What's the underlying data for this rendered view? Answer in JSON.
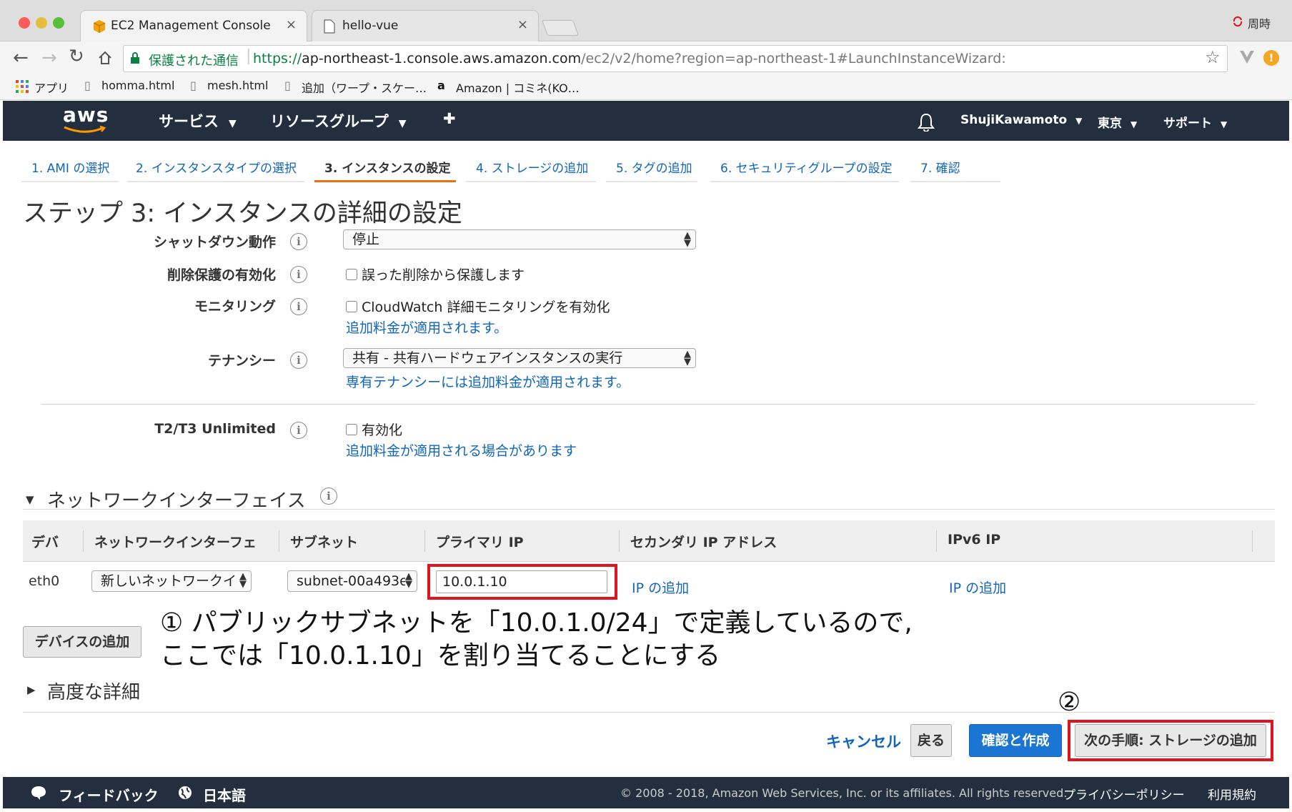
{
  "browser": {
    "tabs": [
      {
        "title": "EC2 Management Console",
        "icon": "aws-cube-icon"
      },
      {
        "title": "hello-vue",
        "icon": "page-icon"
      }
    ],
    "profile_label": "周時",
    "secure_label": "保護された通信",
    "url_scheme": "https://",
    "url_host": "ap-northeast-1.console.aws.amazon.com",
    "url_path": "/ec2/v2/home?region=ap-northeast-1#LaunchInstanceWizard:",
    "bookmarks": [
      "アプリ",
      "homma.html",
      "mesh.html",
      "追加（ワープ・スケー…",
      "Amazon | コミネ(KO…"
    ]
  },
  "nav": {
    "logo": "aws",
    "services": "サービス",
    "resource_groups": "リソースグループ",
    "user": "ShujiKawamoto",
    "region": "東京",
    "support": "サポート"
  },
  "steps": [
    "1. AMI の選択",
    "2. インスタンスタイプの選択",
    "3. インスタンスの設定",
    "4. ストレージの追加",
    "5. タグの追加",
    "6. セキュリティグループの設定",
    "7. 確認"
  ],
  "page_title": "ステップ 3: インスタンスの詳細の設定",
  "form": {
    "shutdown_label": "シャットダウン動作",
    "shutdown_value": "停止",
    "termination_label": "削除保護の有効化",
    "termination_checkbox": "誤った削除から保護します",
    "monitoring_label": "モニタリング",
    "monitoring_checkbox": "CloudWatch 詳細モニタリングを有効化",
    "monitoring_link": "追加料金が適用されます。",
    "tenancy_label": "テナンシー",
    "tenancy_value": "共有 - 共有ハードウェアインスタンスの実行",
    "tenancy_link": "専有テナンシーには追加料金が適用されます。",
    "t2t3_label": "T2/T3 Unlimited",
    "t2t3_checkbox": "有効化",
    "t2t3_link": "追加料金が適用される場合があります"
  },
  "network": {
    "section_title": "ネットワークインターフェイス",
    "headers": [
      "デバ",
      "ネットワークインターフェ",
      "サブネット",
      "プライマリ IP",
      "セカンダリ IP アドレス",
      "IPv6 IP"
    ],
    "row": {
      "device": "eth0",
      "interface": "新しいネットワークイ",
      "subnet": "subnet-00a493e",
      "primary_ip": "10.0.1.10",
      "secondary_ip_link": "IP の追加",
      "ipv6_link": "IP の追加"
    },
    "add_device": "デバイスの追加"
  },
  "annotation": {
    "note_line1": "① パブリックサブネットを「10.0.1.0/24」で定義しているので,",
    "note_line2": "ここでは「10.0.1.10」を割り当てることにする",
    "marker2": "②"
  },
  "advanced_title": "高度な詳細",
  "actions": {
    "cancel": "キャンセル",
    "back": "戻る",
    "review": "確認と作成",
    "next": "次の手順: ストレージの追加"
  },
  "footer": {
    "feedback": "フィードバック",
    "language": "日本語",
    "copyright": "© 2008 - 2018, Amazon Web Services, Inc. or its affiliates. All rights reserved.",
    "privacy": "プライバシーポリシー",
    "terms": "利用規約"
  },
  "colors": {
    "accent_red": "#e0141e",
    "link": "#1166bb",
    "nav_bg": "#232f3e",
    "step_active": "#ec7211"
  }
}
